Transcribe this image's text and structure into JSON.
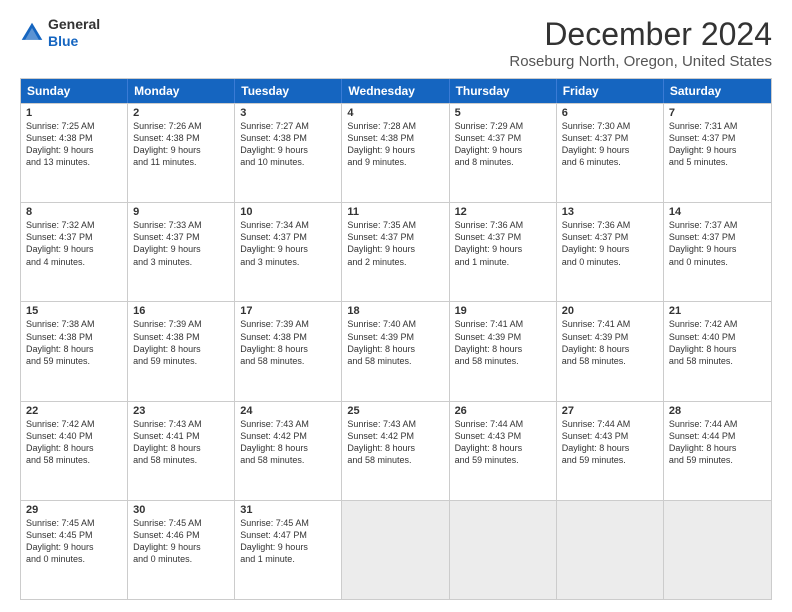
{
  "header": {
    "logo_general": "General",
    "logo_blue": "Blue",
    "main_title": "December 2024",
    "subtitle": "Roseburg North, Oregon, United States"
  },
  "calendar": {
    "days": [
      "Sunday",
      "Monday",
      "Tuesday",
      "Wednesday",
      "Thursday",
      "Friday",
      "Saturday"
    ],
    "rows": [
      [
        {
          "day": "1",
          "lines": [
            "Sunrise: 7:25 AM",
            "Sunset: 4:38 PM",
            "Daylight: 9 hours",
            "and 13 minutes."
          ]
        },
        {
          "day": "2",
          "lines": [
            "Sunrise: 7:26 AM",
            "Sunset: 4:38 PM",
            "Daylight: 9 hours",
            "and 11 minutes."
          ]
        },
        {
          "day": "3",
          "lines": [
            "Sunrise: 7:27 AM",
            "Sunset: 4:38 PM",
            "Daylight: 9 hours",
            "and 10 minutes."
          ]
        },
        {
          "day": "4",
          "lines": [
            "Sunrise: 7:28 AM",
            "Sunset: 4:38 PM",
            "Daylight: 9 hours",
            "and 9 minutes."
          ]
        },
        {
          "day": "5",
          "lines": [
            "Sunrise: 7:29 AM",
            "Sunset: 4:37 PM",
            "Daylight: 9 hours",
            "and 8 minutes."
          ]
        },
        {
          "day": "6",
          "lines": [
            "Sunrise: 7:30 AM",
            "Sunset: 4:37 PM",
            "Daylight: 9 hours",
            "and 6 minutes."
          ]
        },
        {
          "day": "7",
          "lines": [
            "Sunrise: 7:31 AM",
            "Sunset: 4:37 PM",
            "Daylight: 9 hours",
            "and 5 minutes."
          ]
        }
      ],
      [
        {
          "day": "8",
          "lines": [
            "Sunrise: 7:32 AM",
            "Sunset: 4:37 PM",
            "Daylight: 9 hours",
            "and 4 minutes."
          ]
        },
        {
          "day": "9",
          "lines": [
            "Sunrise: 7:33 AM",
            "Sunset: 4:37 PM",
            "Daylight: 9 hours",
            "and 3 minutes."
          ]
        },
        {
          "day": "10",
          "lines": [
            "Sunrise: 7:34 AM",
            "Sunset: 4:37 PM",
            "Daylight: 9 hours",
            "and 3 minutes."
          ]
        },
        {
          "day": "11",
          "lines": [
            "Sunrise: 7:35 AM",
            "Sunset: 4:37 PM",
            "Daylight: 9 hours",
            "and 2 minutes."
          ]
        },
        {
          "day": "12",
          "lines": [
            "Sunrise: 7:36 AM",
            "Sunset: 4:37 PM",
            "Daylight: 9 hours",
            "and 1 minute."
          ]
        },
        {
          "day": "13",
          "lines": [
            "Sunrise: 7:36 AM",
            "Sunset: 4:37 PM",
            "Daylight: 9 hours",
            "and 0 minutes."
          ]
        },
        {
          "day": "14",
          "lines": [
            "Sunrise: 7:37 AM",
            "Sunset: 4:37 PM",
            "Daylight: 9 hours",
            "and 0 minutes."
          ]
        }
      ],
      [
        {
          "day": "15",
          "lines": [
            "Sunrise: 7:38 AM",
            "Sunset: 4:38 PM",
            "Daylight: 8 hours",
            "and 59 minutes."
          ]
        },
        {
          "day": "16",
          "lines": [
            "Sunrise: 7:39 AM",
            "Sunset: 4:38 PM",
            "Daylight: 8 hours",
            "and 59 minutes."
          ]
        },
        {
          "day": "17",
          "lines": [
            "Sunrise: 7:39 AM",
            "Sunset: 4:38 PM",
            "Daylight: 8 hours",
            "and 58 minutes."
          ]
        },
        {
          "day": "18",
          "lines": [
            "Sunrise: 7:40 AM",
            "Sunset: 4:39 PM",
            "Daylight: 8 hours",
            "and 58 minutes."
          ]
        },
        {
          "day": "19",
          "lines": [
            "Sunrise: 7:41 AM",
            "Sunset: 4:39 PM",
            "Daylight: 8 hours",
            "and 58 minutes."
          ]
        },
        {
          "day": "20",
          "lines": [
            "Sunrise: 7:41 AM",
            "Sunset: 4:39 PM",
            "Daylight: 8 hours",
            "and 58 minutes."
          ]
        },
        {
          "day": "21",
          "lines": [
            "Sunrise: 7:42 AM",
            "Sunset: 4:40 PM",
            "Daylight: 8 hours",
            "and 58 minutes."
          ]
        }
      ],
      [
        {
          "day": "22",
          "lines": [
            "Sunrise: 7:42 AM",
            "Sunset: 4:40 PM",
            "Daylight: 8 hours",
            "and 58 minutes."
          ]
        },
        {
          "day": "23",
          "lines": [
            "Sunrise: 7:43 AM",
            "Sunset: 4:41 PM",
            "Daylight: 8 hours",
            "and 58 minutes."
          ]
        },
        {
          "day": "24",
          "lines": [
            "Sunrise: 7:43 AM",
            "Sunset: 4:42 PM",
            "Daylight: 8 hours",
            "and 58 minutes."
          ]
        },
        {
          "day": "25",
          "lines": [
            "Sunrise: 7:43 AM",
            "Sunset: 4:42 PM",
            "Daylight: 8 hours",
            "and 58 minutes."
          ]
        },
        {
          "day": "26",
          "lines": [
            "Sunrise: 7:44 AM",
            "Sunset: 4:43 PM",
            "Daylight: 8 hours",
            "and 59 minutes."
          ]
        },
        {
          "day": "27",
          "lines": [
            "Sunrise: 7:44 AM",
            "Sunset: 4:43 PM",
            "Daylight: 8 hours",
            "and 59 minutes."
          ]
        },
        {
          "day": "28",
          "lines": [
            "Sunrise: 7:44 AM",
            "Sunset: 4:44 PM",
            "Daylight: 8 hours",
            "and 59 minutes."
          ]
        }
      ],
      [
        {
          "day": "29",
          "lines": [
            "Sunrise: 7:45 AM",
            "Sunset: 4:45 PM",
            "Daylight: 9 hours",
            "and 0 minutes."
          ]
        },
        {
          "day": "30",
          "lines": [
            "Sunrise: 7:45 AM",
            "Sunset: 4:46 PM",
            "Daylight: 9 hours",
            "and 0 minutes."
          ]
        },
        {
          "day": "31",
          "lines": [
            "Sunrise: 7:45 AM",
            "Sunset: 4:47 PM",
            "Daylight: 9 hours",
            "and 1 minute."
          ]
        },
        {
          "day": "",
          "lines": []
        },
        {
          "day": "",
          "lines": []
        },
        {
          "day": "",
          "lines": []
        },
        {
          "day": "",
          "lines": []
        }
      ]
    ]
  }
}
